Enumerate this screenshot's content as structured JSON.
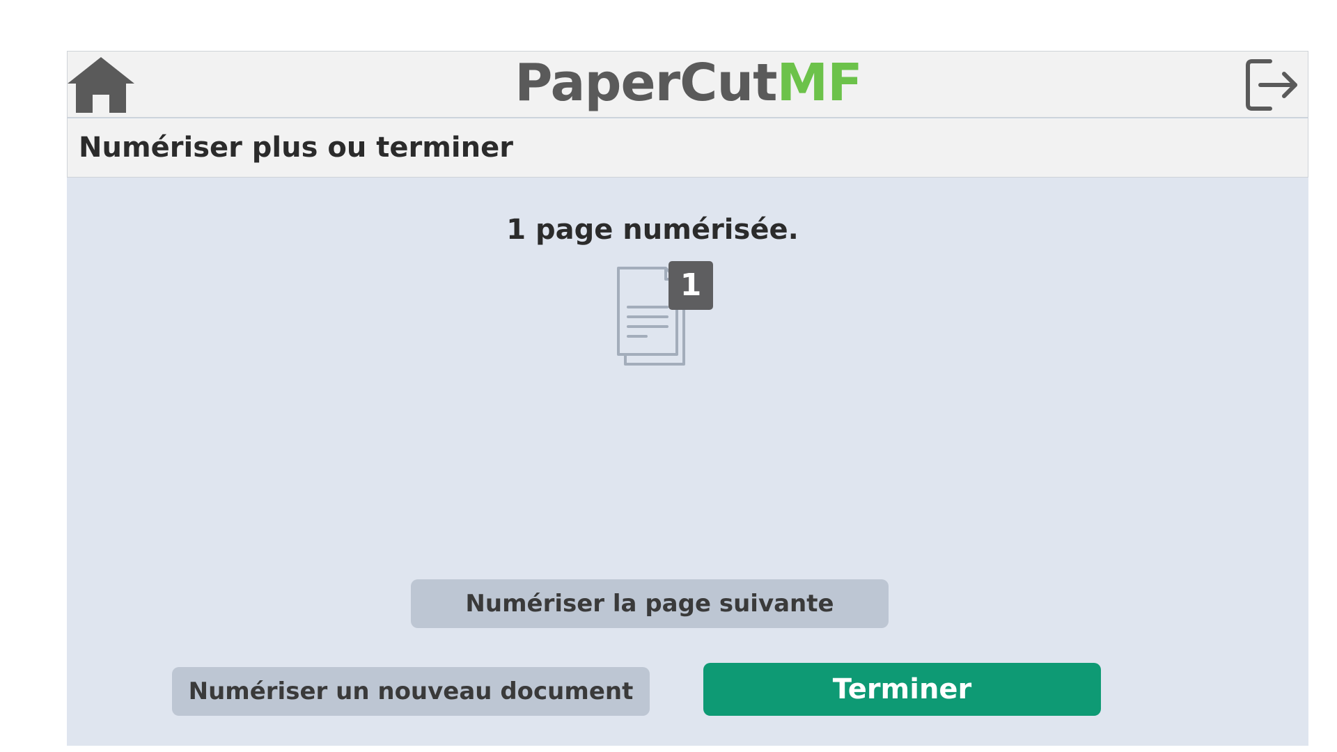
{
  "header": {
    "logo_main": "PaperCut",
    "logo_accent": "MF"
  },
  "screen": {
    "title": "Numériser plus ou terminer",
    "status": "1 page numérisée.",
    "page_count": "1"
  },
  "actions": {
    "next_page_label": "Numériser la page suivante",
    "new_document_label": "Numériser un nouveau document",
    "finish_label": "Terminer"
  },
  "icons": {
    "home": "home-icon",
    "logout": "logout-icon",
    "document": "document-stack-icon"
  },
  "colors": {
    "header_bg": "#f2f2f2",
    "content_bg": "#dfe5ef",
    "logo_text": "#5a5a5a",
    "logo_accent": "#6cc24a",
    "primary_button": "#0e9a74",
    "secondary_button": "#bdc6d3",
    "badge": "#5e5e60",
    "icon_gray": "#5a5a5a"
  }
}
